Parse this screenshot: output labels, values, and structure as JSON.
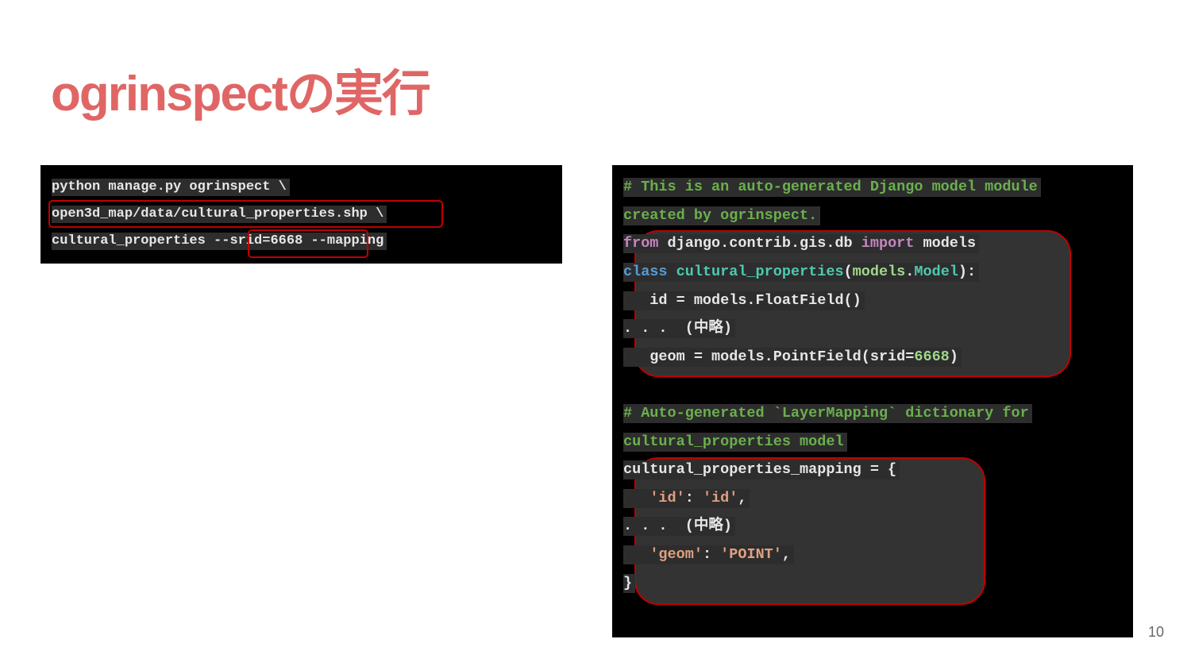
{
  "slide": {
    "title": "ogrinspectの実行",
    "page_number": "10"
  },
  "command": {
    "line1": "python manage.py ogrinspect \\",
    "line2_path": "open3d_map/data/cultural_properties.shp",
    "line2_tail": " \\",
    "line3_head": "cultural_properties ",
    "line3_srid": "--srid=6668",
    "line3_tail": " --mapping"
  },
  "model_code": {
    "comment1_a": "# This is an auto-generated Django model module",
    "comment1_b": "created by ogrinspect.",
    "from_kw": "from",
    "from_mod": " django.contrib.gis.db ",
    "import_kw": "import",
    "import_name": " models",
    "class_kw": "class",
    "class_name": " cultural_properties",
    "class_paren_open": "(",
    "class_base_mod": "models",
    "class_dot": ".",
    "class_base": "Model",
    "class_end": "):",
    "id_line": "   id = models.FloatField()",
    "omit1": ". . .  (中略)",
    "geom_head": "   geom = models.PointField(srid=",
    "geom_num": "6668",
    "geom_tail": ")",
    "comment2_a": "# Auto-generated `LayerMapping` dictionary for",
    "comment2_b": "cultural_properties model",
    "mapping_open": "cultural_properties_mapping = {",
    "map_id_indent": "   ",
    "map_id_key": "'id'",
    "map_id_colon": ": ",
    "map_id_val": "'id'",
    "map_id_comma": ",",
    "omit2": ". . .  (中略)",
    "map_geom_indent": "   ",
    "map_geom_key": "'geom'",
    "map_geom_colon": ": ",
    "map_geom_val": "'POINT'",
    "map_geom_comma": ",",
    "mapping_close": "}"
  },
  "colors": {
    "title": "#e06666",
    "highlight_border": "#c00000",
    "comment": "#6ab04c",
    "keyword": "#c586c0"
  }
}
